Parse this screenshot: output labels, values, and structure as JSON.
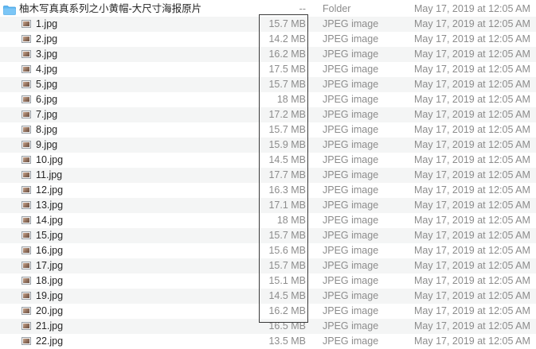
{
  "folder": {
    "name": "柚木写真真系列之小黄帽-大尺寸海报原片",
    "size": "--",
    "kind": "Folder",
    "date": "May 17, 2019 at 12:05 AM"
  },
  "files": [
    {
      "name": "1.jpg",
      "size": "15.7 MB",
      "kind": "JPEG image",
      "date": "May 17, 2019 at 12:05 AM"
    },
    {
      "name": "2.jpg",
      "size": "14.2 MB",
      "kind": "JPEG image",
      "date": "May 17, 2019 at 12:05 AM"
    },
    {
      "name": "3.jpg",
      "size": "16.2 MB",
      "kind": "JPEG image",
      "date": "May 17, 2019 at 12:05 AM"
    },
    {
      "name": "4.jpg",
      "size": "17.5 MB",
      "kind": "JPEG image",
      "date": "May 17, 2019 at 12:05 AM"
    },
    {
      "name": "5.jpg",
      "size": "15.7 MB",
      "kind": "JPEG image",
      "date": "May 17, 2019 at 12:05 AM"
    },
    {
      "name": "6.jpg",
      "size": "18 MB",
      "kind": "JPEG image",
      "date": "May 17, 2019 at 12:05 AM"
    },
    {
      "name": "7.jpg",
      "size": "17.2 MB",
      "kind": "JPEG image",
      "date": "May 17, 2019 at 12:05 AM"
    },
    {
      "name": "8.jpg",
      "size": "15.7 MB",
      "kind": "JPEG image",
      "date": "May 17, 2019 at 12:05 AM"
    },
    {
      "name": "9.jpg",
      "size": "15.9 MB",
      "kind": "JPEG image",
      "date": "May 17, 2019 at 12:05 AM"
    },
    {
      "name": "10.jpg",
      "size": "14.5 MB",
      "kind": "JPEG image",
      "date": "May 17, 2019 at 12:05 AM"
    },
    {
      "name": "11.jpg",
      "size": "17.7 MB",
      "kind": "JPEG image",
      "date": "May 17, 2019 at 12:05 AM"
    },
    {
      "name": "12.jpg",
      "size": "16.3 MB",
      "kind": "JPEG image",
      "date": "May 17, 2019 at 12:05 AM"
    },
    {
      "name": "13.jpg",
      "size": "17.1 MB",
      "kind": "JPEG image",
      "date": "May 17, 2019 at 12:05 AM"
    },
    {
      "name": "14.jpg",
      "size": "18 MB",
      "kind": "JPEG image",
      "date": "May 17, 2019 at 12:05 AM"
    },
    {
      "name": "15.jpg",
      "size": "15.7 MB",
      "kind": "JPEG image",
      "date": "May 17, 2019 at 12:05 AM"
    },
    {
      "name": "16.jpg",
      "size": "15.6 MB",
      "kind": "JPEG image",
      "date": "May 17, 2019 at 12:05 AM"
    },
    {
      "name": "17.jpg",
      "size": "15.7 MB",
      "kind": "JPEG image",
      "date": "May 17, 2019 at 12:05 AM"
    },
    {
      "name": "18.jpg",
      "size": "15.1 MB",
      "kind": "JPEG image",
      "date": "May 17, 2019 at 12:05 AM"
    },
    {
      "name": "19.jpg",
      "size": "14.5 MB",
      "kind": "JPEG image",
      "date": "May 17, 2019 at 12:05 AM"
    },
    {
      "name": "20.jpg",
      "size": "16.2 MB",
      "kind": "JPEG image",
      "date": "May 17, 2019 at 12:05 AM"
    },
    {
      "name": "21.jpg",
      "size": "16.5 MB",
      "kind": "JPEG image",
      "date": "May 17, 2019 at 12:05 AM"
    },
    {
      "name": "22.jpg",
      "size": "13.5 MB",
      "kind": "JPEG image",
      "date": "May 17, 2019 at 12:05 AM"
    }
  ],
  "colors": {
    "folder_blue": "#5fb7f2",
    "stripe": "#f4f5f5",
    "meta_text": "#8c8c8c",
    "highlight_border": "#3a3a3a"
  },
  "icons": {
    "folder": "folder-icon",
    "file": "jpeg-thumbnail-icon"
  }
}
